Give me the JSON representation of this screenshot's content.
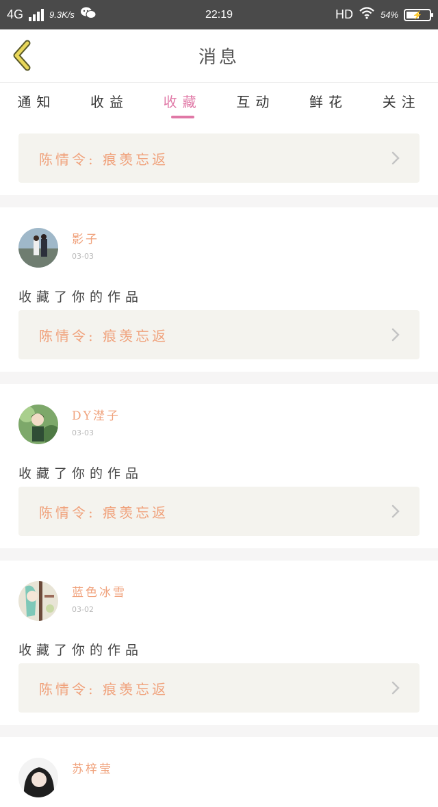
{
  "status_bar": {
    "network": "4G",
    "speed": "9.3K/s",
    "time": "22:19",
    "hd": "HD",
    "battery_pct": "54%"
  },
  "header": {
    "title": "消息"
  },
  "tabs": [
    {
      "label": "通知"
    },
    {
      "label": "收益"
    },
    {
      "label": "收藏",
      "active": true
    },
    {
      "label": "互动"
    },
    {
      "label": "鲜花"
    },
    {
      "label": "关注"
    }
  ],
  "items": [
    {
      "work_title": "陈情令:  痕羡忘返"
    },
    {
      "username": "影子",
      "date": "03-03",
      "action": "收藏了你的作品",
      "work_title": "陈情令:  痕羡忘返"
    },
    {
      "username": "DY漜子",
      "date": "03-03",
      "action": "收藏了你的作品",
      "work_title": "陈情令:  痕羡忘返"
    },
    {
      "username": "蓝色冰雪",
      "date": "03-02",
      "action": "收藏了你的作品",
      "work_title": "陈情令:  痕羡忘返"
    },
    {
      "username": "苏梓莹"
    }
  ],
  "colors": {
    "accent": "#e078a6",
    "title_orange": "#f0a27c",
    "card_bg": "#f4f3ee",
    "status_bar": "#4a4a4a"
  }
}
